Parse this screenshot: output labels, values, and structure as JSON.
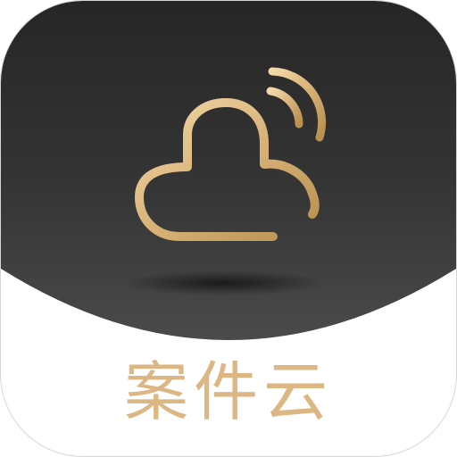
{
  "app": {
    "name": "案件云",
    "icon": "cloud-with-signal-icon"
  },
  "colors": {
    "dark_top": "#2a2a2a",
    "dark_bottom": "#4a4a4a",
    "gold_light": "#f3d9a8",
    "gold_mid": "#d8b278",
    "gold_dark": "#b8904f",
    "label": "#dcb683",
    "background": "#ffffff"
  }
}
